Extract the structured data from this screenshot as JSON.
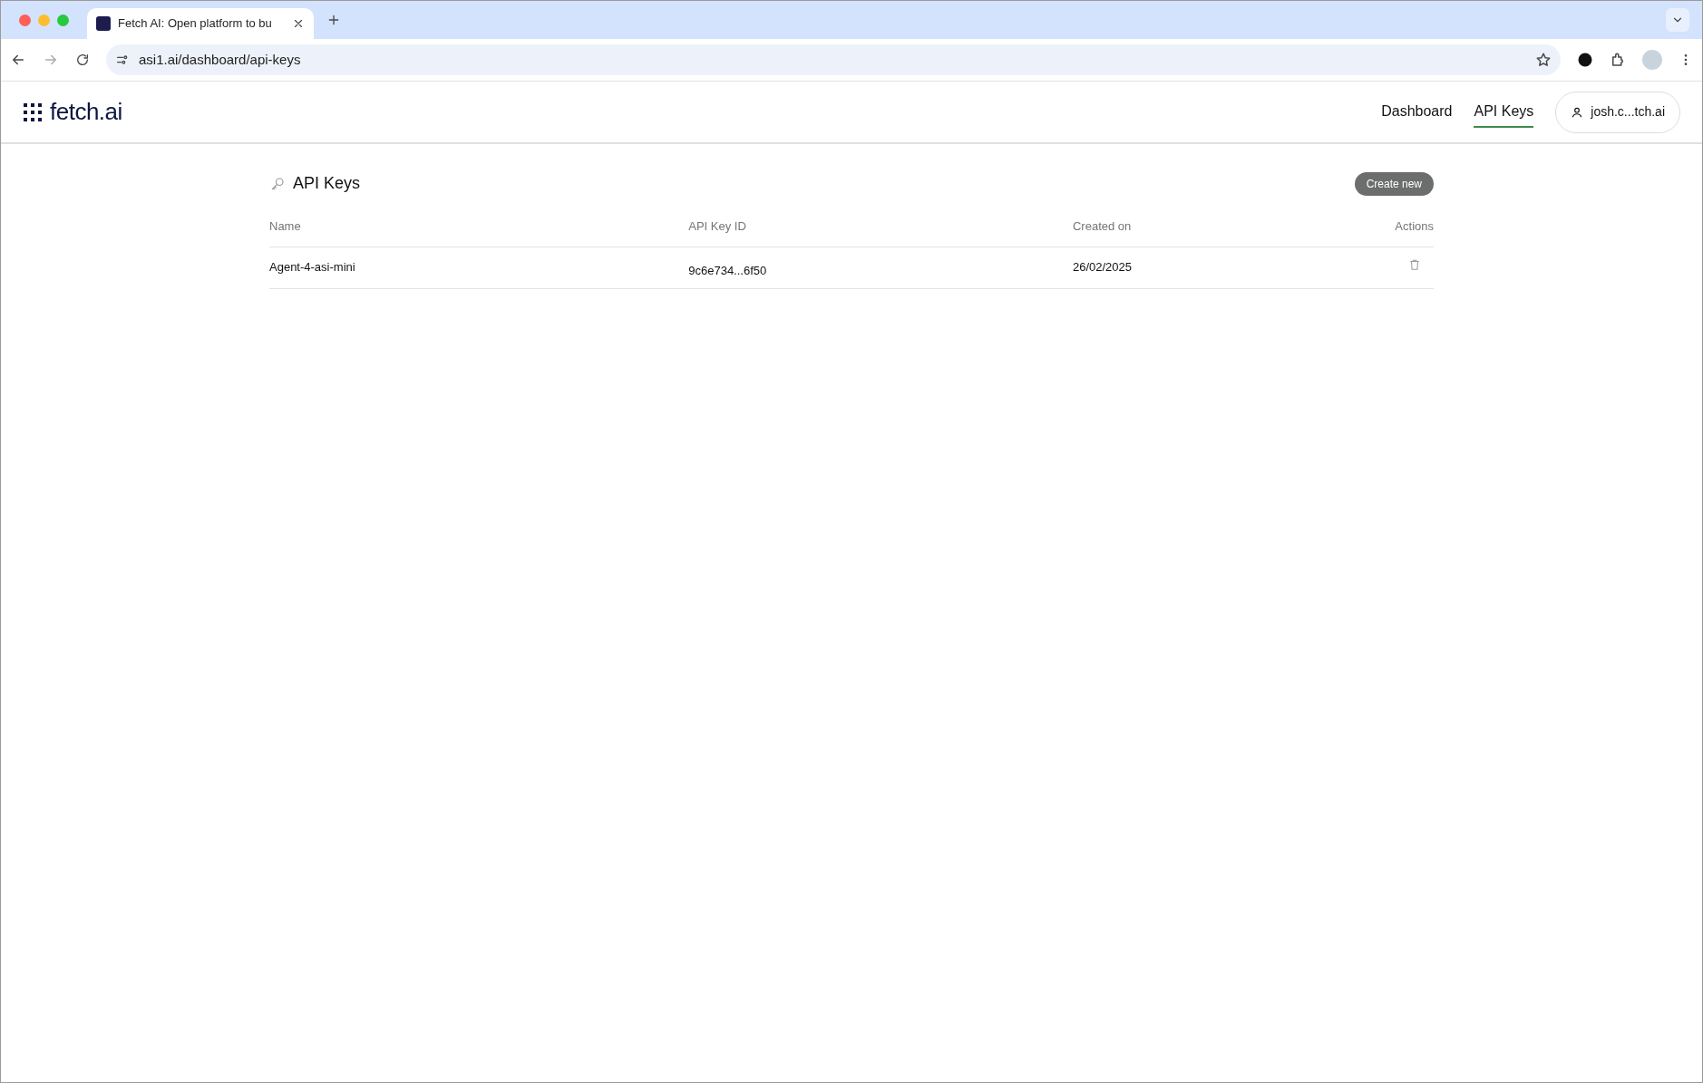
{
  "browser": {
    "tabs": [
      {
        "title": "Fetch AI: Open platform to bu",
        "selected": true
      }
    ],
    "url": "asi1.ai/dashboard/api-keys"
  },
  "header": {
    "logo": "fetch.ai",
    "nav": [
      {
        "label": "Dashboard",
        "selected": false
      },
      {
        "label": "API Keys",
        "selected": true
      }
    ],
    "user": "josh.c...tch.ai"
  },
  "page": {
    "title": "API Keys",
    "create_button": "Create new"
  },
  "table": {
    "columns": [
      "Name",
      "API Key ID",
      "Created on",
      "Actions"
    ],
    "rows": [
      {
        "name": "Agent-4-asi-mini",
        "key_id": "9c6e734...6f50",
        "created": "26/02/2025"
      }
    ]
  }
}
